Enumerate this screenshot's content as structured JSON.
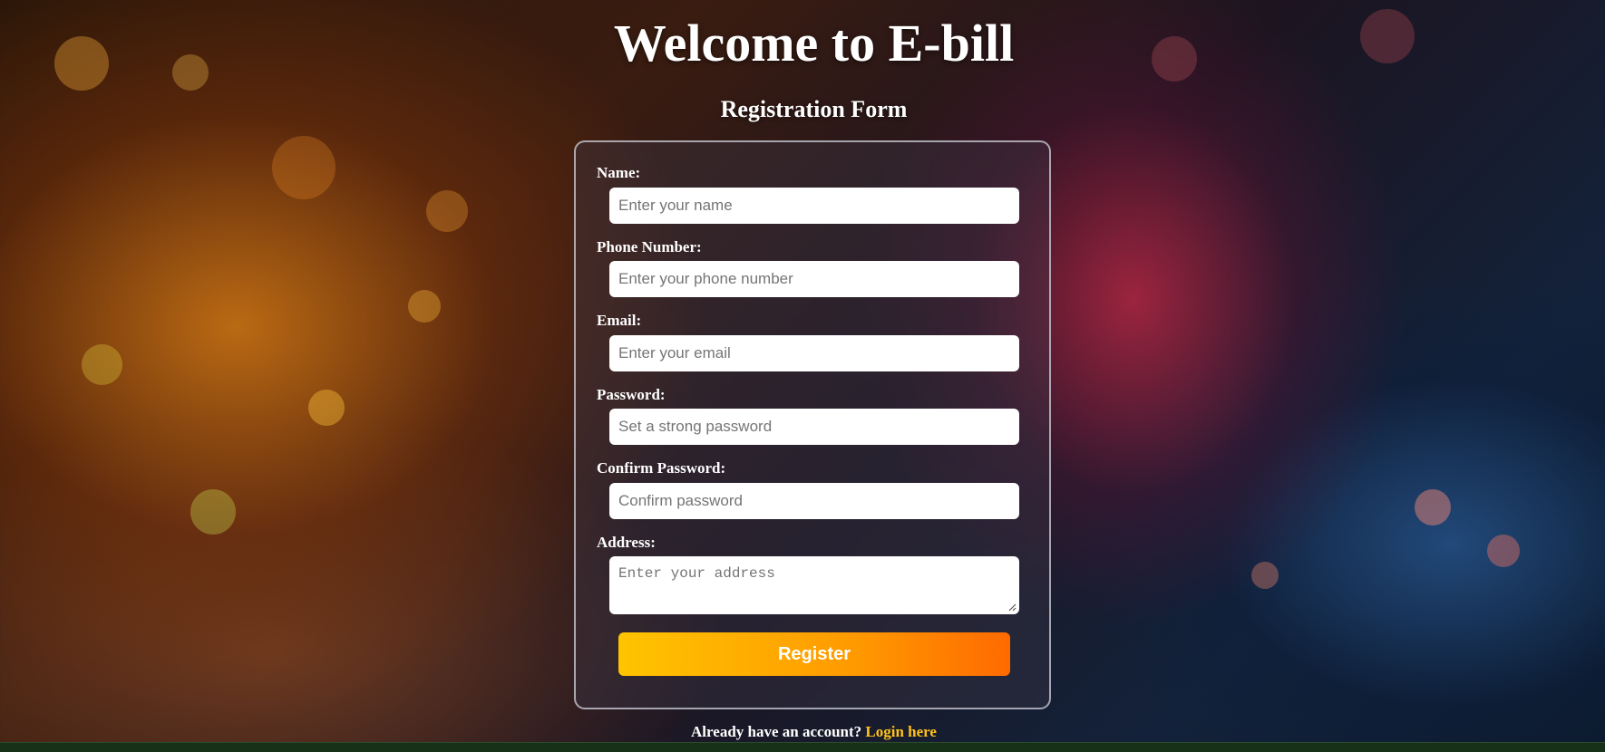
{
  "header": {
    "title": "Welcome to E-bill",
    "subtitle": "Registration Form"
  },
  "form": {
    "fields": [
      {
        "label": "Name:",
        "placeholder": "Enter your name"
      },
      {
        "label": "Phone Number:",
        "placeholder": "Enter your phone number"
      },
      {
        "label": "Email:",
        "placeholder": "Enter your email"
      },
      {
        "label": "Password:",
        "placeholder": "Set a strong password"
      },
      {
        "label": "Confirm Password:",
        "placeholder": "Confirm password"
      },
      {
        "label": "Address:",
        "placeholder": "Enter your address"
      }
    ],
    "submit_label": "Register"
  },
  "footer": {
    "prompt": "Already have an account?",
    "login_link": "Login here"
  },
  "colors": {
    "accent_start": "#ffc400",
    "accent_end": "#ff6a00",
    "link": "#ffc21a"
  }
}
